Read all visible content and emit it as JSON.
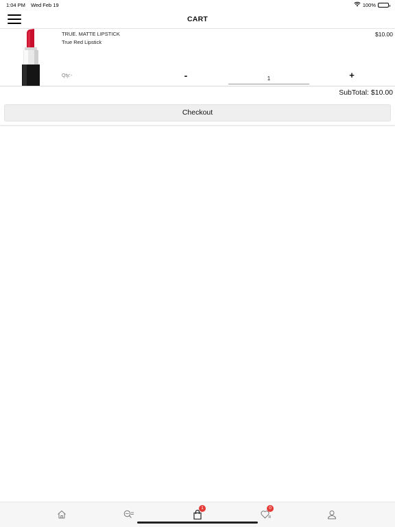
{
  "status_bar": {
    "time": "1:04 PM",
    "date": "Wed Feb 19",
    "battery": "100%"
  },
  "nav": {
    "title": "CART"
  },
  "cart": {
    "items": [
      {
        "brand": "TRUE. MATTE LIPSTICK",
        "name": "True Red Lipstick",
        "price": "$10.00",
        "qty_label": "Qty:-",
        "qty_value": "1",
        "minus_label": "-",
        "plus_label": "+"
      }
    ],
    "subtotal": "SubTotal: $10.00",
    "checkout_label": "Checkout"
  },
  "tab_bar": {
    "tabs": [
      {
        "icon": "home-icon"
      },
      {
        "icon": "search-icon"
      },
      {
        "icon": "shopping-bag-icon",
        "badge": "1"
      },
      {
        "icon": "heart-icon",
        "badge": "0"
      },
      {
        "icon": "user-icon"
      }
    ]
  },
  "colors": {
    "badge": "#e53935",
    "lipstick": "#c8102e"
  }
}
